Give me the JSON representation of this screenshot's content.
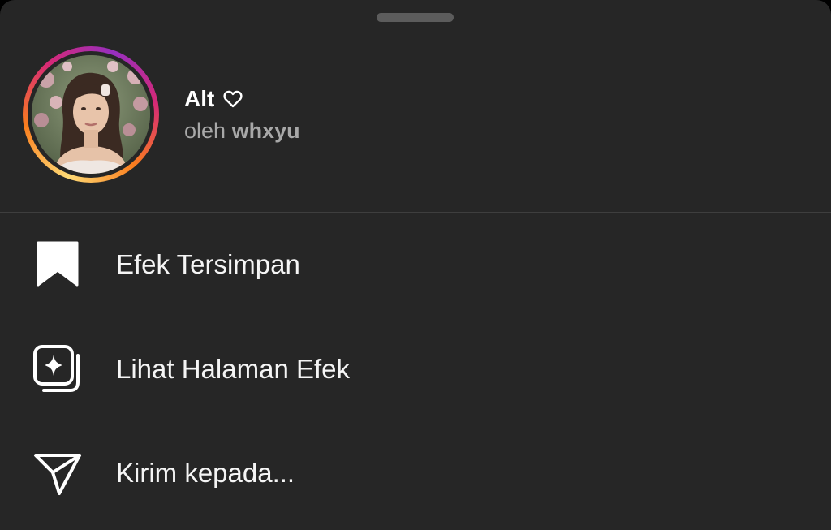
{
  "sheet": {
    "effect_name": "Alt",
    "by_prefix": "oleh",
    "author": "whxyu"
  },
  "menu": {
    "items": [
      {
        "label": "Efek Tersimpan",
        "icon": "bookmark-icon"
      },
      {
        "label": "Lihat Halaman Efek",
        "icon": "effect-page-icon"
      },
      {
        "label": "Kirim kepada...",
        "icon": "send-icon"
      }
    ]
  },
  "colors": {
    "sheet_background": "#262626",
    "text_primary": "#ffffff",
    "text_secondary": "#a8a8a8",
    "ring_gradient": [
      "#feda75",
      "#fa7e1e",
      "#d62976",
      "#962fbf"
    ]
  }
}
